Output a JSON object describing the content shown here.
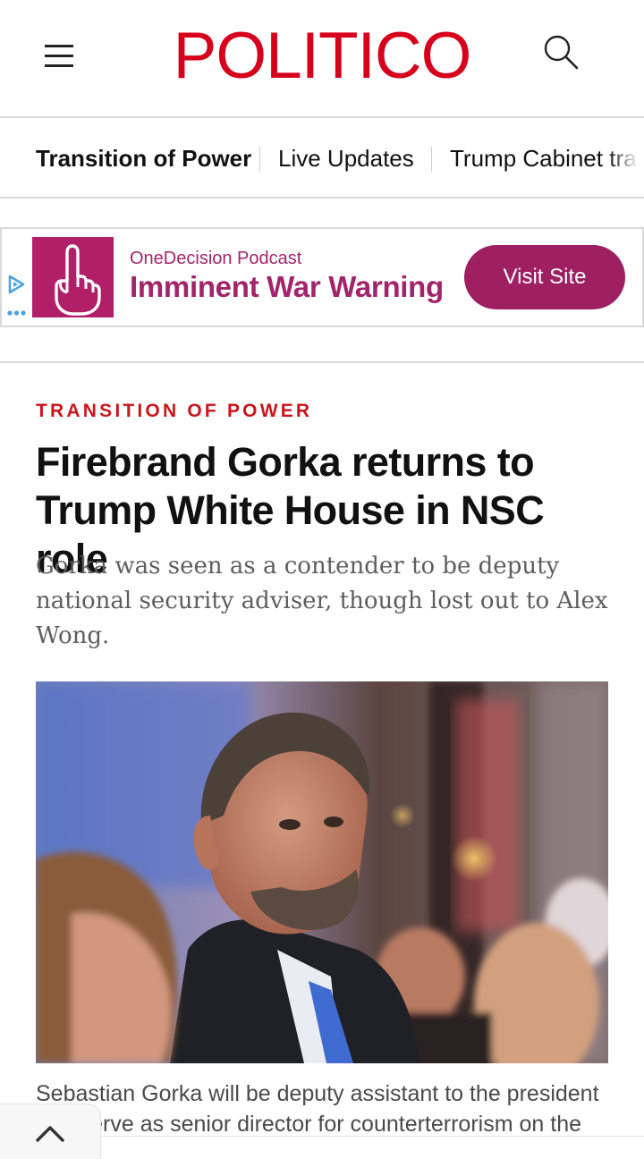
{
  "header": {
    "logo_text": "POLITICO",
    "brand_color": "#d6001c",
    "menu_icon": "hamburger-menu-icon",
    "search_icon": "search-icon"
  },
  "tabs": [
    {
      "label": "Transition of Power",
      "active": true
    },
    {
      "label": "Live Updates",
      "active": false
    },
    {
      "label": "Trump Cabinet tra",
      "active": false
    }
  ],
  "ad": {
    "sponsor": "OneDecision Podcast",
    "headline": "Imminent War Warning",
    "cta_label": "Visit Site",
    "accent_color": "#9e1f62",
    "thumb_icon": "raised-finger-hand-icon",
    "adchoices_icon": "adchoices-icon"
  },
  "article": {
    "kicker": "TRANSITION OF POWER",
    "kicker_color": "#c9161d",
    "headline": "Firebrand Gorka returns to Trump White House in NSC role",
    "dek": "Gorka was seen as a contender to be deputy national security adviser, though lost out to Alex Wong.",
    "caption": "Sebastian Gorka will be deputy assistant to the president and serve as senior director for counterterrorism on the NSC, within the White House."
  },
  "back_to_top_icon": "chevron-up-icon"
}
